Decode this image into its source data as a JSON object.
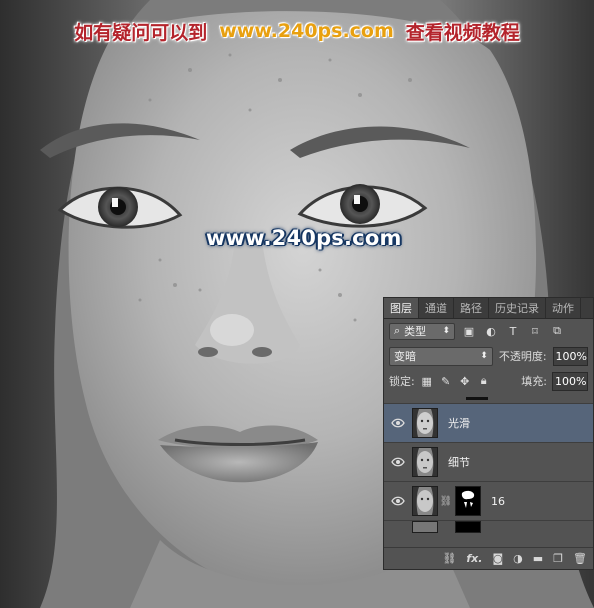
{
  "banner": {
    "left_text": "如有疑问可以到",
    "url": "www.240ps.com",
    "right_text": "查看视频教程"
  },
  "watermark": "www.240ps.com",
  "layers_panel": {
    "tabs": [
      "图层",
      "通道",
      "路径",
      "历史记录",
      "动作"
    ],
    "active_tab": "图层",
    "filter_label": "类型",
    "blend_mode": "变暗",
    "opacity_label": "不透明度:",
    "opacity_value": "100%",
    "lock_label": "锁定:",
    "fill_label": "填充:",
    "fill_value": "100%",
    "layers": [
      {
        "name": "光滑",
        "selected": true,
        "visible": true
      },
      {
        "name": "细节",
        "selected": false,
        "visible": true
      },
      {
        "name": "16",
        "selected": false,
        "visible": true,
        "has_mask": true
      }
    ],
    "footer_icons": [
      "link-icon",
      "fx-icon",
      "mask-icon",
      "adjustment-icon",
      "folder-icon",
      "new-layer-icon",
      "trash-icon"
    ],
    "fx_label": "fx."
  },
  "colors": {
    "banner_red": "#b4242c",
    "banner_orange": "#e8a010",
    "panel_bg": "#535353",
    "selected_layer": "#56657a"
  }
}
